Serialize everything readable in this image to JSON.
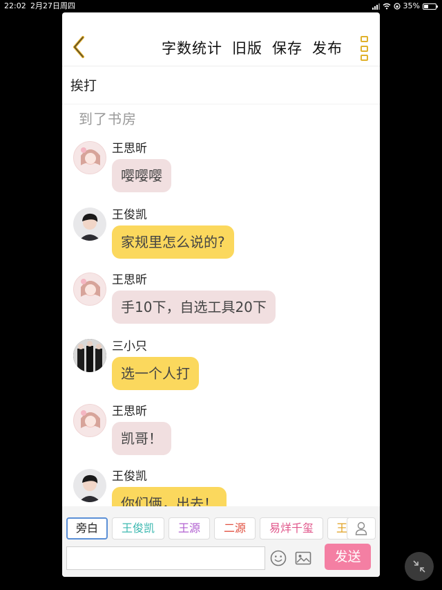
{
  "status_bar": {
    "time": "22:02",
    "date": "2月27日周四",
    "battery": "35%"
  },
  "header": {
    "actions": [
      "字数统计",
      "旧版",
      "保存",
      "发布"
    ],
    "accent_color": "#e0b12b"
  },
  "chapter_title": "挨打",
  "narration": "到了书房",
  "messages": [
    {
      "sender": "王思昕",
      "text": "嘤嘤嘤",
      "avatar": "girl",
      "bubble": "pink"
    },
    {
      "sender": "王俊凯",
      "text": "家规里怎么说的?",
      "avatar": "boy",
      "bubble": "yellow"
    },
    {
      "sender": "王思昕",
      "text": "手10下，自选工具20下",
      "avatar": "girl",
      "bubble": "pink"
    },
    {
      "sender": "三小只",
      "text": "选一个人打",
      "avatar": "group",
      "bubble": "yellow"
    },
    {
      "sender": "王思昕",
      "text": "凯哥！",
      "avatar": "girl",
      "bubble": "pink"
    },
    {
      "sender": "王俊凯",
      "text": "你们俩，出去！",
      "avatar": "boy",
      "bubble": "yellow"
    }
  ],
  "role_chips": [
    {
      "label": "旁白",
      "color": "#222222"
    },
    {
      "label": "王俊凯",
      "color": "#3cb8b0"
    },
    {
      "label": "王源",
      "color": "#b05fd0"
    },
    {
      "label": "二源",
      "color": "#e05040"
    },
    {
      "label": "易烊千玺",
      "color": "#e0558a"
    },
    {
      "label": "王",
      "color": "#e0a020"
    }
  ],
  "composer": {
    "placeholder": "",
    "send_label": "发送",
    "send_color": "#f47fa3"
  }
}
